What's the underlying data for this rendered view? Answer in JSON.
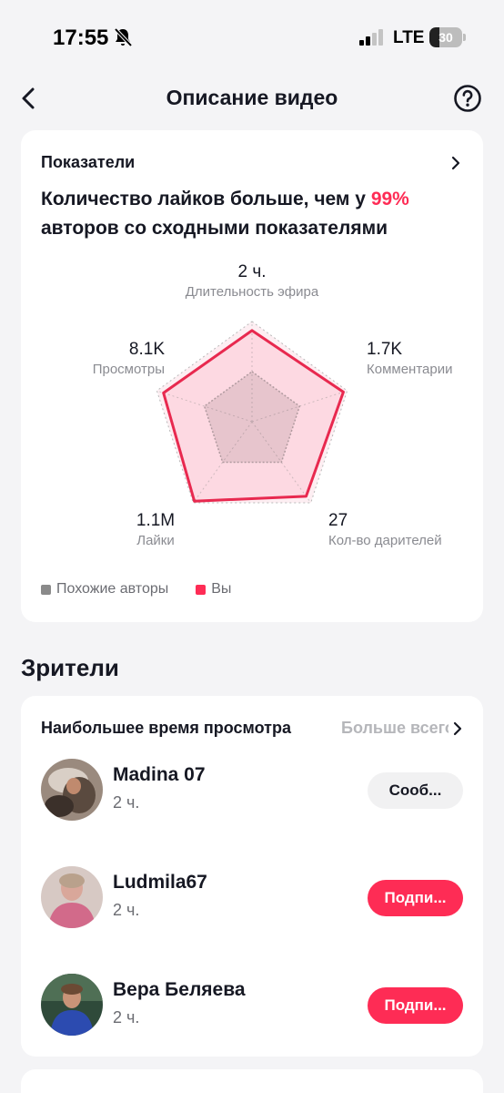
{
  "status_bar": {
    "time": "17:55",
    "network": "LTE",
    "battery": "30",
    "battery_level_percent": 30,
    "icons": [
      "bell-muted-icon",
      "signal-icon"
    ]
  },
  "header": {
    "title": "Описание видео",
    "icons": [
      "back-arrow-icon",
      "help-icon"
    ]
  },
  "metrics": {
    "section_label": "Показатели",
    "headline_prefix": "Количество лайков больше, чем у ",
    "headline_highlight": "99%",
    "headline_suffix": "авторов со сходными показателями",
    "axes": [
      {
        "value": "2 ч.",
        "name": "Длительность эфира"
      },
      {
        "value": "1.7K",
        "name": "Комментарии"
      },
      {
        "value": "27",
        "name": "Кол-во дарителей"
      },
      {
        "value": "1.1M",
        "name": "Лайки"
      },
      {
        "value": "8.1K",
        "name": "Просмотры"
      }
    ],
    "legend": [
      {
        "label": "Похожие авторы",
        "color": "#8a8a8a"
      },
      {
        "label": "Вы",
        "color": "#fe2c55"
      }
    ],
    "colors": {
      "accent": "#fe2c55",
      "similar": "#8a8a8a"
    }
  },
  "chart_data": {
    "type": "radar",
    "categories": [
      "Длительность эфира",
      "Комментарии",
      "Кол-во дарителей",
      "Лайки",
      "Просмотры"
    ],
    "series": [
      {
        "name": "Похожие авторы",
        "values": [
          0.5,
          0.5,
          0.5,
          0.5,
          0.5
        ]
      },
      {
        "name": "Вы",
        "values": [
          0.91,
          0.96,
          0.92,
          0.98,
          0.93
        ]
      }
    ],
    "ylim": [
      0,
      1
    ],
    "grid": true,
    "legend_position": "bottom-left"
  },
  "viewers": {
    "section_title": "Зрители",
    "card_title": "Наибольшее время просмотра",
    "more_label": "Больше всего",
    "items": [
      {
        "name": "Madina 07",
        "duration": "2 ч.",
        "action": "Сооб...",
        "action_type": "message"
      },
      {
        "name": "Ludmila67",
        "duration": "2 ч.",
        "action": "Подпи...",
        "action_type": "follow"
      },
      {
        "name": "Вера Беляева",
        "duration": "2 ч.",
        "action": "Подпи...",
        "action_type": "follow"
      }
    ]
  }
}
